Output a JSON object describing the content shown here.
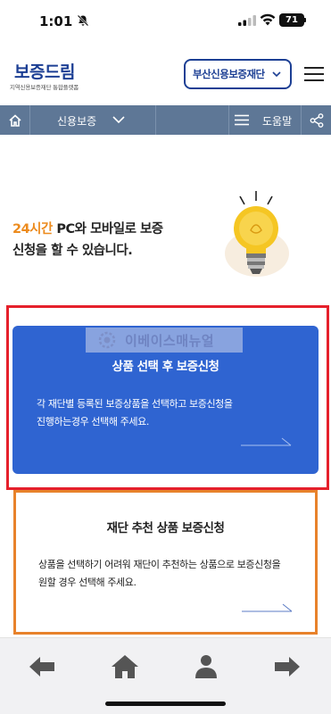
{
  "status_bar": {
    "time": "1:01",
    "battery": "71"
  },
  "header": {
    "logo_title": "보증드림",
    "logo_subtitle": "지역신용보증재단 통합플랫폼",
    "foundation_select": "부산신용보증재단"
  },
  "nav": {
    "category": "신용보증",
    "help": "도움말"
  },
  "intro": {
    "highlight": "24시간",
    "line1_rest": " PC와 모바일로 보증",
    "line2": "신청을 할 수 있습니다."
  },
  "watermark": {
    "text": "이베이스매뉴얼"
  },
  "cards": [
    {
      "title": "상품 선택 후 보증신청",
      "desc_line1": "각 재단별 등록된 보증상품을 선택하고 보증신청을",
      "desc_line2": "진행하는경우 선택해 주세요."
    },
    {
      "title": "재단 추천 상품 보증신청",
      "desc_line1": "상품을 선택하기 어려워 재단이 추천하는 상품으로 보증신청을",
      "desc_line2": "원할 경우 선택해 주세요."
    }
  ],
  "colors": {
    "brand_navy": "#1c3f94",
    "nav_bg": "#5e7796",
    "highlight_orange": "#ec8b1e",
    "card_blue": "#2f64d1",
    "frame_red": "#e5202b",
    "frame_orange": "#e8822b"
  },
  "icons": {
    "status": [
      "bell-slash-icon",
      "cell-signal-icon",
      "wifi-icon",
      "battery-icon"
    ],
    "header": [
      "chevron-down-icon",
      "hamburger-menu-icon"
    ],
    "nav": [
      "home-icon",
      "chevron-down-icon",
      "list-icon",
      "share-icon"
    ],
    "toolbar": [
      "back-arrow-icon",
      "home-icon",
      "person-icon",
      "forward-arrow-icon"
    ]
  }
}
